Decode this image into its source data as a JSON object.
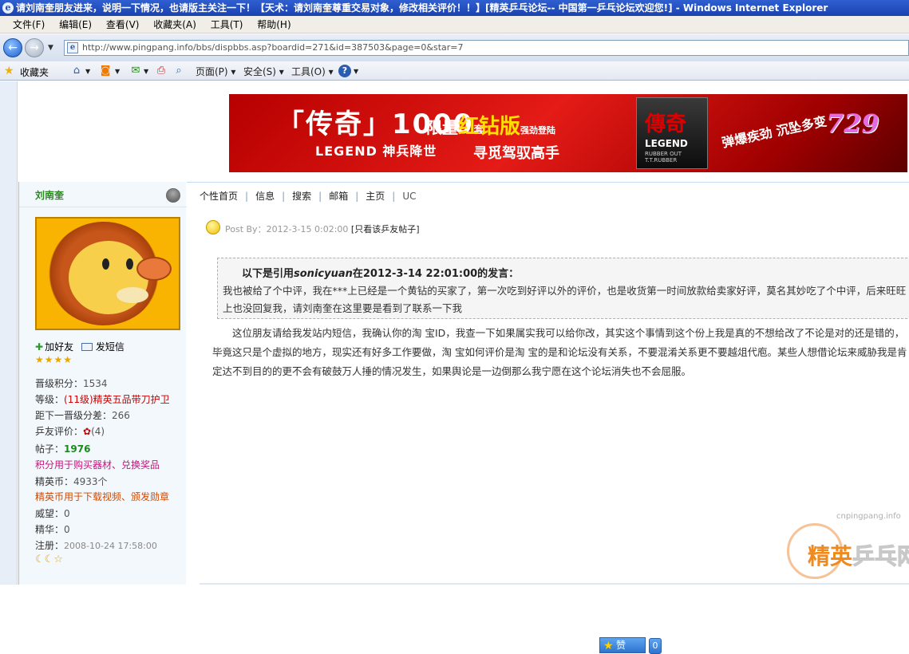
{
  "window": {
    "title": "请刘南奎朋友进来，说明一下情况，也请版主关注一下！【天术：请刘南奎尊重交易对象，修改相关评价！！】[精英乒乓论坛-- 中国第一乒乓论坛欢迎您!] - Windows Internet Explorer"
  },
  "menu": {
    "items": [
      "文件(F)",
      "编辑(E)",
      "查看(V)",
      "收藏夹(A)",
      "工具(T)",
      "帮助(H)"
    ]
  },
  "address": {
    "url": "http://www.pingpang.info/bbs/dispbbs.asp?boardid=271&id=387503&page=0&star=7"
  },
  "toolbar": {
    "favorites": "收藏夹",
    "page": "页面(P)",
    "safety": "安全(S)",
    "tools": "工具(O)"
  },
  "banner": {
    "line1": "「传奇」1000",
    "line1_small": "套",
    "line2_a": "限量",
    "line2_b": "红钻版",
    "line2_c": "强劲登陆",
    "line3": "LEGEND 神兵降世",
    "line4": "寻觅驾驭高手",
    "box_title": "傳奇",
    "box_sub": "LEGEND",
    "box_small": "RUBBER OUT T.T.RUBBER",
    "slogan": "弹爆疾劲 沉坠多变",
    "brand": "729"
  },
  "sidebar": {
    "username": "刘南奎",
    "add_friend": "加好友",
    "send_message": "发短信",
    "rank_stars": "★★★★",
    "stats": [
      {
        "label": "晋级积分：",
        "value": "1534"
      },
      {
        "label": "等级：",
        "value": "(11级)精英五品带刀护卫"
      },
      {
        "label": "距下一晋级分差：",
        "value": "266"
      },
      {
        "label": "乒友评价：",
        "value": "(4)"
      },
      {
        "label": "帖子：",
        "value": "1976"
      }
    ],
    "points_note": "积分用于购买器材、兑换奖品",
    "coins_label": "精英币：",
    "coins_value": "4933个",
    "coins_note": "精英币用于下载视频、颁发勋章",
    "prestige_label": "威望：",
    "prestige_value": "0",
    "essence_label": "精华：",
    "essence_value": "0",
    "register_label": "注册：",
    "register_value": "2008-10-24 17:58:00",
    "badges": "☾☾☆"
  },
  "topnav": {
    "items": [
      "个性首页",
      "信息",
      "搜索",
      "邮箱",
      "主页",
      "UC"
    ]
  },
  "post": {
    "post_by": "Post By：2012-3-15 0:02:00",
    "only_this_user": "[只看该乒友帖子]",
    "quote_prefix": "以下是引用",
    "quote_user": "sonicyuan",
    "quote_suffix": "在2012-3-14 22:01:00的发言：",
    "quote_text": "我也被给了个中评，我在***上已经是一个黄钻的买家了，第一次吃到好评以外的评价，也是收货第一时间放款给卖家好评，莫名其妙吃了个中评，后来旺旺上也没回复我，请刘南奎在这里要是看到了联系一下我",
    "body": "这位朋友请给我发站内短信，我确认你的淘  宝ID，我查一下如果属实我可以给你改，其实这个事情到这个份上我是真的不想给改了不论是对的还是错的，毕竟这只是个虚拟的地方，现实还有好多工作要做，淘  宝如何评价是淘  宝的是和论坛没有关系，不要混淆关系更不要越俎代庖。某些人想借论坛来威胁我是肯定达不到目的的更不会有破鼓万人捶的情况发生，如果舆论是一边倒那么我宁愿在这个论坛消失也不会屈服。",
    "like_label": "赞",
    "like_count": "0"
  },
  "watermark": {
    "url": "cnpingpang.info",
    "text_a": "精英",
    "text_b": "乒乓网"
  },
  "colors": {
    "titlebar": "#1a43b0",
    "username_green": "#2a8a1e",
    "sidebar_bg": "#f3f8fd",
    "banner_red": "#e41b16"
  }
}
